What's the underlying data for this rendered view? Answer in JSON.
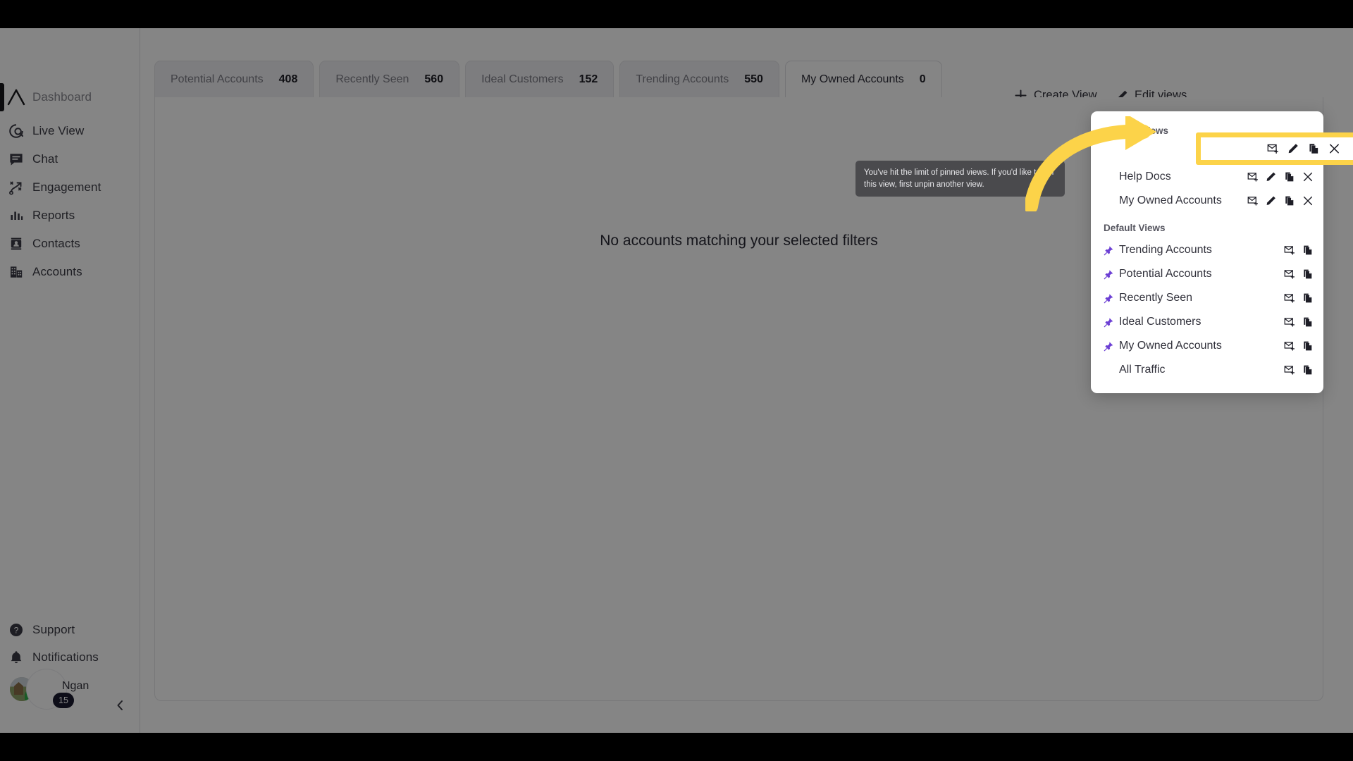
{
  "app": {
    "brand_letter": "g.",
    "accent_yellow": "#fcd349",
    "pin_purple": "#6c3fd4"
  },
  "sidebar": {
    "logo_icon": "triangle-logo-icon",
    "items": [
      {
        "label": "Dashboard",
        "icon": "triangle-logo-icon",
        "muted": true
      },
      {
        "label": "Live View",
        "icon": "live-view-icon",
        "muted": false
      },
      {
        "label": "Chat",
        "icon": "chat-icon",
        "muted": false
      },
      {
        "label": "Engagement",
        "icon": "engagement-icon",
        "muted": false
      },
      {
        "label": "Reports",
        "icon": "reports-bar-icon",
        "muted": false
      },
      {
        "label": "Contacts",
        "icon": "contacts-icon",
        "muted": false
      },
      {
        "label": "Accounts",
        "icon": "accounts-building-icon",
        "muted": false
      }
    ],
    "bottom_items": [
      {
        "label": "Support",
        "icon": "help-circle-icon"
      },
      {
        "label": "Notifications",
        "icon": "bell-icon"
      }
    ],
    "profile": {
      "name": "Ngan",
      "badge_count": "15",
      "avatar_icon": "user-avatar",
      "brand_icon": "brand-g-icon"
    },
    "collapse_icon": "chevron-left-icon"
  },
  "topbar": {
    "tabs": [
      {
        "label": "Potential Accounts",
        "count": "408",
        "active": false
      },
      {
        "label": "Recently Seen",
        "count": "560",
        "active": false
      },
      {
        "label": "Ideal Customers",
        "count": "152",
        "active": false
      },
      {
        "label": "Trending Accounts",
        "count": "550",
        "active": false
      },
      {
        "label": "My Owned Accounts",
        "count": "0",
        "active": true
      }
    ],
    "create_view": {
      "label": "Create View",
      "icon": "plus-icon"
    },
    "edit_views": {
      "label": "Edit views",
      "icon": "pencil-icon"
    }
  },
  "main": {
    "empty_state": "No accounts matching your selected filters"
  },
  "tooltip": {
    "text": "You've hit the limit of pinned views. If you'd like to pin this view, first unpin another view."
  },
  "dropdown": {
    "custom_views_title": "Custom Views",
    "default_views_title": "Default Views",
    "custom_views": [
      {
        "label": "",
        "pinned": false,
        "actions": [
          "email-add-icon",
          "pencil-icon",
          "copy-icon",
          "close-icon"
        ]
      },
      {
        "label": "Help Docs",
        "pinned": false,
        "actions": [
          "email-add-icon",
          "pencil-icon",
          "copy-icon",
          "close-icon"
        ]
      },
      {
        "label": "My Owned Accounts",
        "pinned": false,
        "actions": [
          "email-add-icon",
          "pencil-icon",
          "copy-icon",
          "close-icon"
        ]
      }
    ],
    "default_views": [
      {
        "label": "Trending Accounts",
        "pinned": true,
        "actions": [
          "email-add-icon",
          "copy-icon"
        ]
      },
      {
        "label": "Potential Accounts",
        "pinned": true,
        "actions": [
          "email-add-icon",
          "copy-icon"
        ]
      },
      {
        "label": "Recently Seen",
        "pinned": true,
        "actions": [
          "email-add-icon",
          "copy-icon"
        ]
      },
      {
        "label": "Ideal Customers",
        "pinned": true,
        "actions": [
          "email-add-icon",
          "copy-icon"
        ]
      },
      {
        "label": "My Owned Accounts",
        "pinned": true,
        "actions": [
          "email-add-icon",
          "copy-icon"
        ]
      },
      {
        "label": "All Traffic",
        "pinned": false,
        "actions": [
          "email-add-icon",
          "copy-icon"
        ]
      }
    ]
  },
  "annotation": {
    "arrow_icon": "curved-arrow-annotation",
    "highlight_icon": "highlight-box-annotation",
    "highlight_actions": [
      "email-add-icon",
      "pencil-icon",
      "copy-icon",
      "close-icon"
    ]
  }
}
